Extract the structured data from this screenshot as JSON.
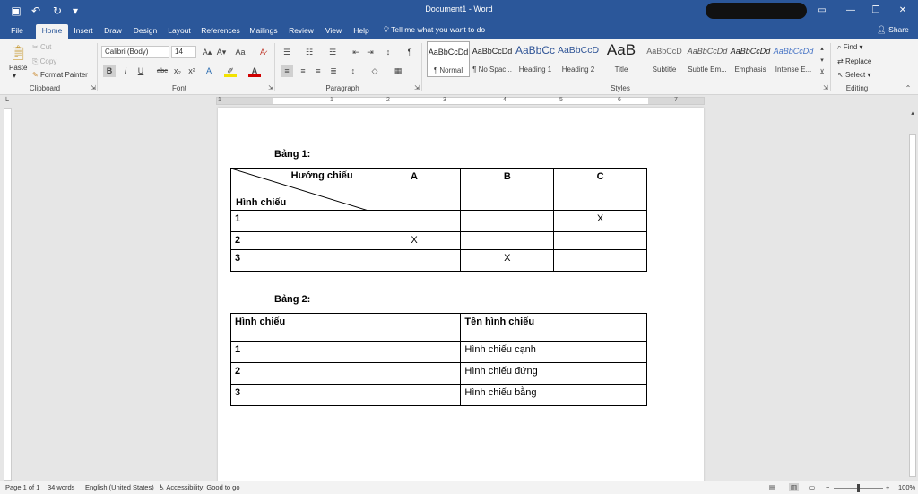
{
  "window": {
    "title": "Document1 - Word",
    "share_label": "Share"
  },
  "tabs": [
    {
      "label": "File"
    },
    {
      "label": "Home"
    },
    {
      "label": "Insert"
    },
    {
      "label": "Draw"
    },
    {
      "label": "Design"
    },
    {
      "label": "Layout"
    },
    {
      "label": "References"
    },
    {
      "label": "Mailings"
    },
    {
      "label": "Review"
    },
    {
      "label": "View"
    },
    {
      "label": "Help"
    }
  ],
  "tell_me": "Tell me what you want to do",
  "clipboard": {
    "paste": "Paste",
    "cut": "Cut",
    "copy": "Copy",
    "format_painter": "Format Painter",
    "group": "Clipboard"
  },
  "font": {
    "name": "Calibri (Body)",
    "size": "14",
    "group": "Font",
    "change_case": "Aa",
    "bold": "B",
    "italic": "I",
    "underline": "U",
    "strike": "abc",
    "subscript": "x₂",
    "superscript": "x²"
  },
  "paragraph": {
    "group": "Paragraph"
  },
  "styles": {
    "group": "Styles",
    "items": [
      {
        "preview": "AaBbCcDd",
        "name": "¶ Normal"
      },
      {
        "preview": "AaBbCcDd",
        "name": "¶ No Spac..."
      },
      {
        "preview": "AaBbCc",
        "name": "Heading 1"
      },
      {
        "preview": "AaBbCcD",
        "name": "Heading 2"
      },
      {
        "preview": "AaB",
        "name": "Title"
      },
      {
        "preview": "AaBbCcD",
        "name": "Subtitle"
      },
      {
        "preview": "AaBbCcDd",
        "name": "Subtle Em..."
      },
      {
        "preview": "AaBbCcDd",
        "name": "Emphasis"
      },
      {
        "preview": "AaBbCcDd",
        "name": "Intense E..."
      }
    ]
  },
  "editing": {
    "group": "Editing",
    "find": "Find",
    "replace": "Replace",
    "select": "Select"
  },
  "ruler_numbers": [
    "1",
    "1",
    "2",
    "3",
    "4",
    "5",
    "6",
    "7"
  ],
  "document": {
    "caption1": "Bảng 1:",
    "table1": {
      "diag_top": "Hướng chiếu",
      "diag_bottom": "Hình chiếu",
      "headers": [
        "A",
        "B",
        "C"
      ],
      "rows": [
        {
          "label": "1",
          "cells": [
            "",
            "",
            "X"
          ]
        },
        {
          "label": "2",
          "cells": [
            "X",
            "",
            ""
          ]
        },
        {
          "label": "3",
          "cells": [
            "",
            "X",
            ""
          ]
        }
      ]
    },
    "caption2": "Bảng 2:",
    "table2": {
      "headers": [
        "Hình chiếu",
        "Tên hình chiếu"
      ],
      "rows": [
        [
          "1",
          "Hình chiếu cạnh"
        ],
        [
          "2",
          "Hình chiếu đứng"
        ],
        [
          "3",
          "Hình chiếu bằng"
        ]
      ]
    }
  },
  "status": {
    "page": "Page 1 of 1",
    "words": "34 words",
    "language": "English (United States)",
    "accessibility": "Accessibility: Good to go",
    "zoom": "100%"
  },
  "colors": {
    "brand": "#2b579a"
  }
}
